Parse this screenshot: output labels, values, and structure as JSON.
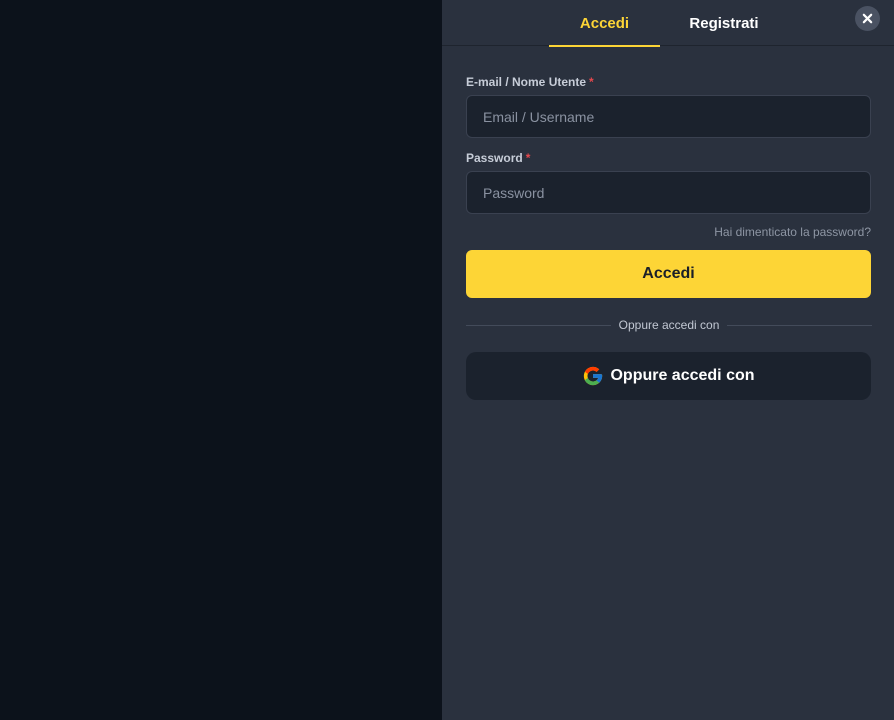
{
  "tabs": {
    "login_label": "Accedi",
    "register_label": "Registrati"
  },
  "close_icon": "close-icon",
  "form": {
    "email_label": "E-mail / Nome Utente",
    "email_placeholder": "Email / Username",
    "email_value": "",
    "password_label": "Password",
    "password_placeholder": "Password",
    "password_value": "",
    "required_marker": "*",
    "forgot_password": "Hai dimenticato la password?",
    "submit_label": "Accedi",
    "divider_text": "Oppure accedi con",
    "google_button_label": "Oppure accedi con",
    "google_icon": "google-icon"
  },
  "colors": {
    "accent": "#fdd536",
    "panel_bg": "#2a313e",
    "backdrop_bg": "#0c121b",
    "input_bg": "#1b222d",
    "required": "#e5484d"
  }
}
